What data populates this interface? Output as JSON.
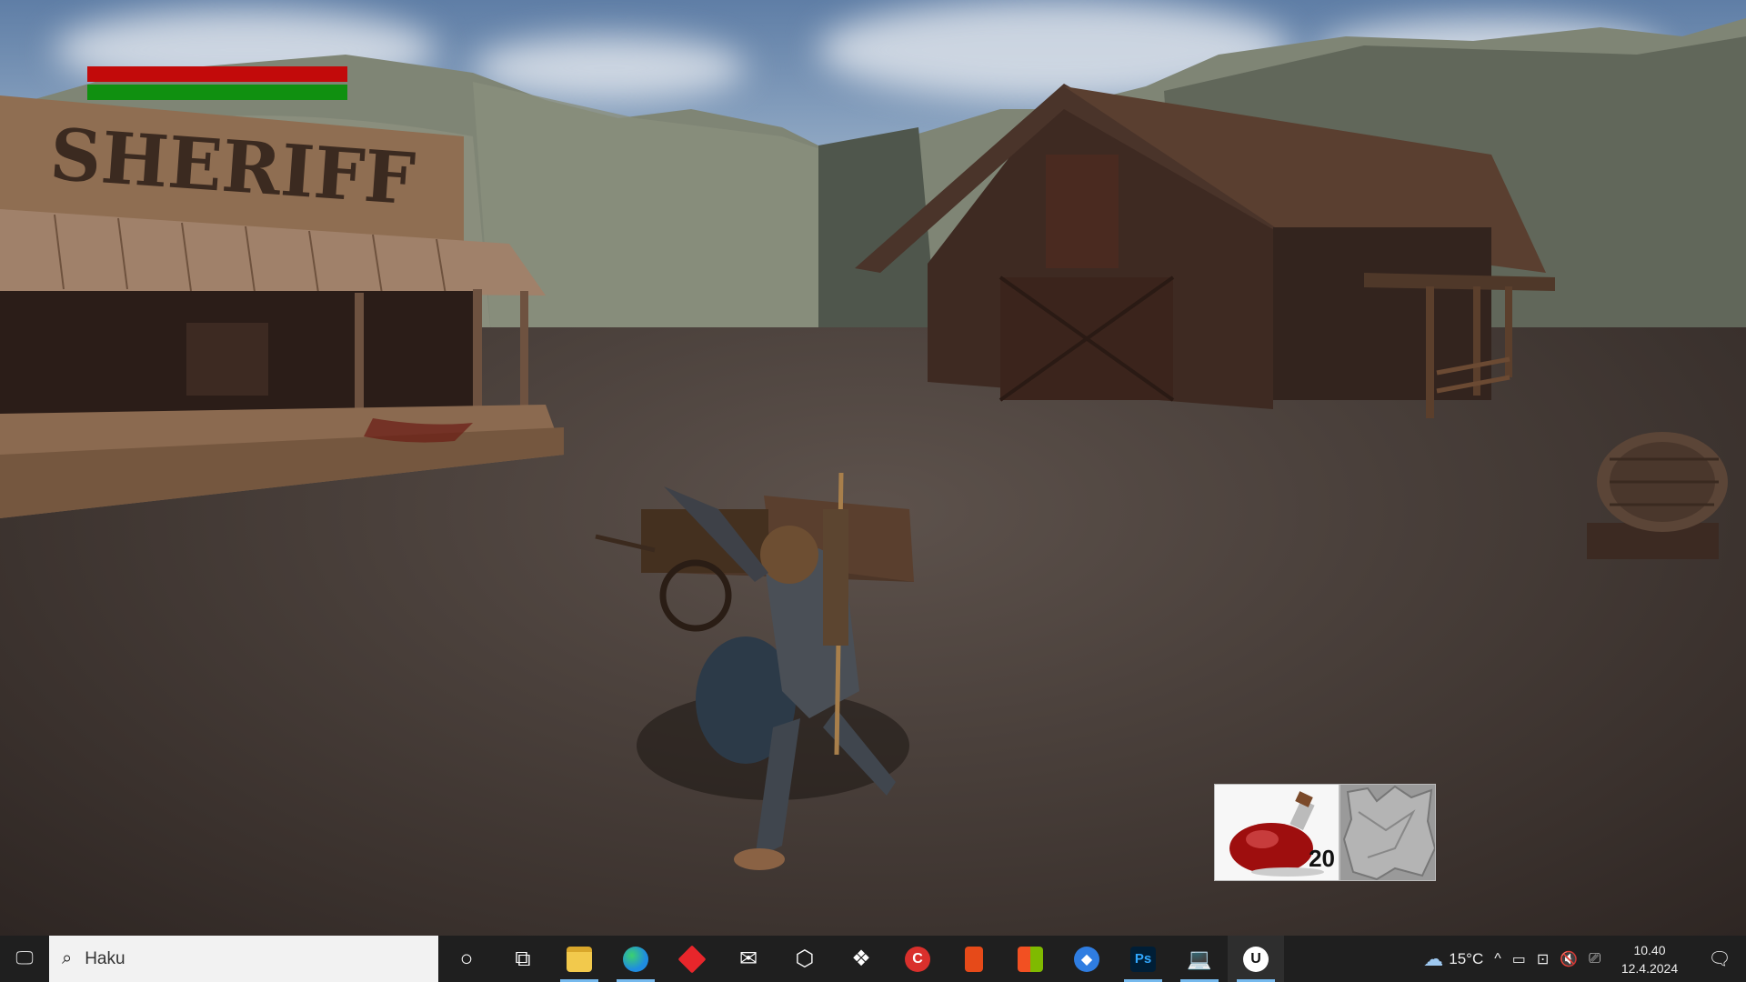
{
  "hud": {
    "health_fraction": 1.0,
    "stamina_fraction": 1.0,
    "colors": {
      "health": "#c20a0a",
      "stamina": "#109010"
    }
  },
  "scene": {
    "sign_text": "SHERIFF"
  },
  "hotbar": {
    "slots": [
      {
        "item": "red-potion-icon",
        "count": "20"
      },
      {
        "item": "empty-slot-icon",
        "count": ""
      }
    ]
  },
  "taskbar": {
    "search_placeholder": "Haku",
    "apps": [
      {
        "name": "cortana-icon",
        "glyph": "○"
      },
      {
        "name": "task-view-icon",
        "glyph": "⧉"
      },
      {
        "name": "file-explorer-icon",
        "color": "#f2c94c"
      },
      {
        "name": "edge-icon",
        "color": "#1f8de0"
      },
      {
        "name": "red-diamond-app-icon",
        "color": "#e8262b"
      },
      {
        "name": "mail-icon",
        "glyph": "✉"
      },
      {
        "name": "steam-like-app-icon",
        "glyph": "⬡"
      },
      {
        "name": "dropbox-icon",
        "glyph": "❖"
      },
      {
        "name": "ccleaner-icon",
        "color": "#d9302c"
      },
      {
        "name": "office-icon",
        "color": "#e64a19"
      },
      {
        "name": "store-icon",
        "color": "#4a90e2"
      },
      {
        "name": "blue-shield-app-icon",
        "color": "#2f7de1"
      },
      {
        "name": "photoshop-icon",
        "label": "Ps",
        "color": "#001e36"
      },
      {
        "name": "laptop-app-icon",
        "glyph": "💻"
      },
      {
        "name": "unreal-engine-icon",
        "label": "U"
      }
    ],
    "tray": {
      "temperature": "15°C",
      "time": "10.40",
      "date": "12.4.2024"
    }
  }
}
